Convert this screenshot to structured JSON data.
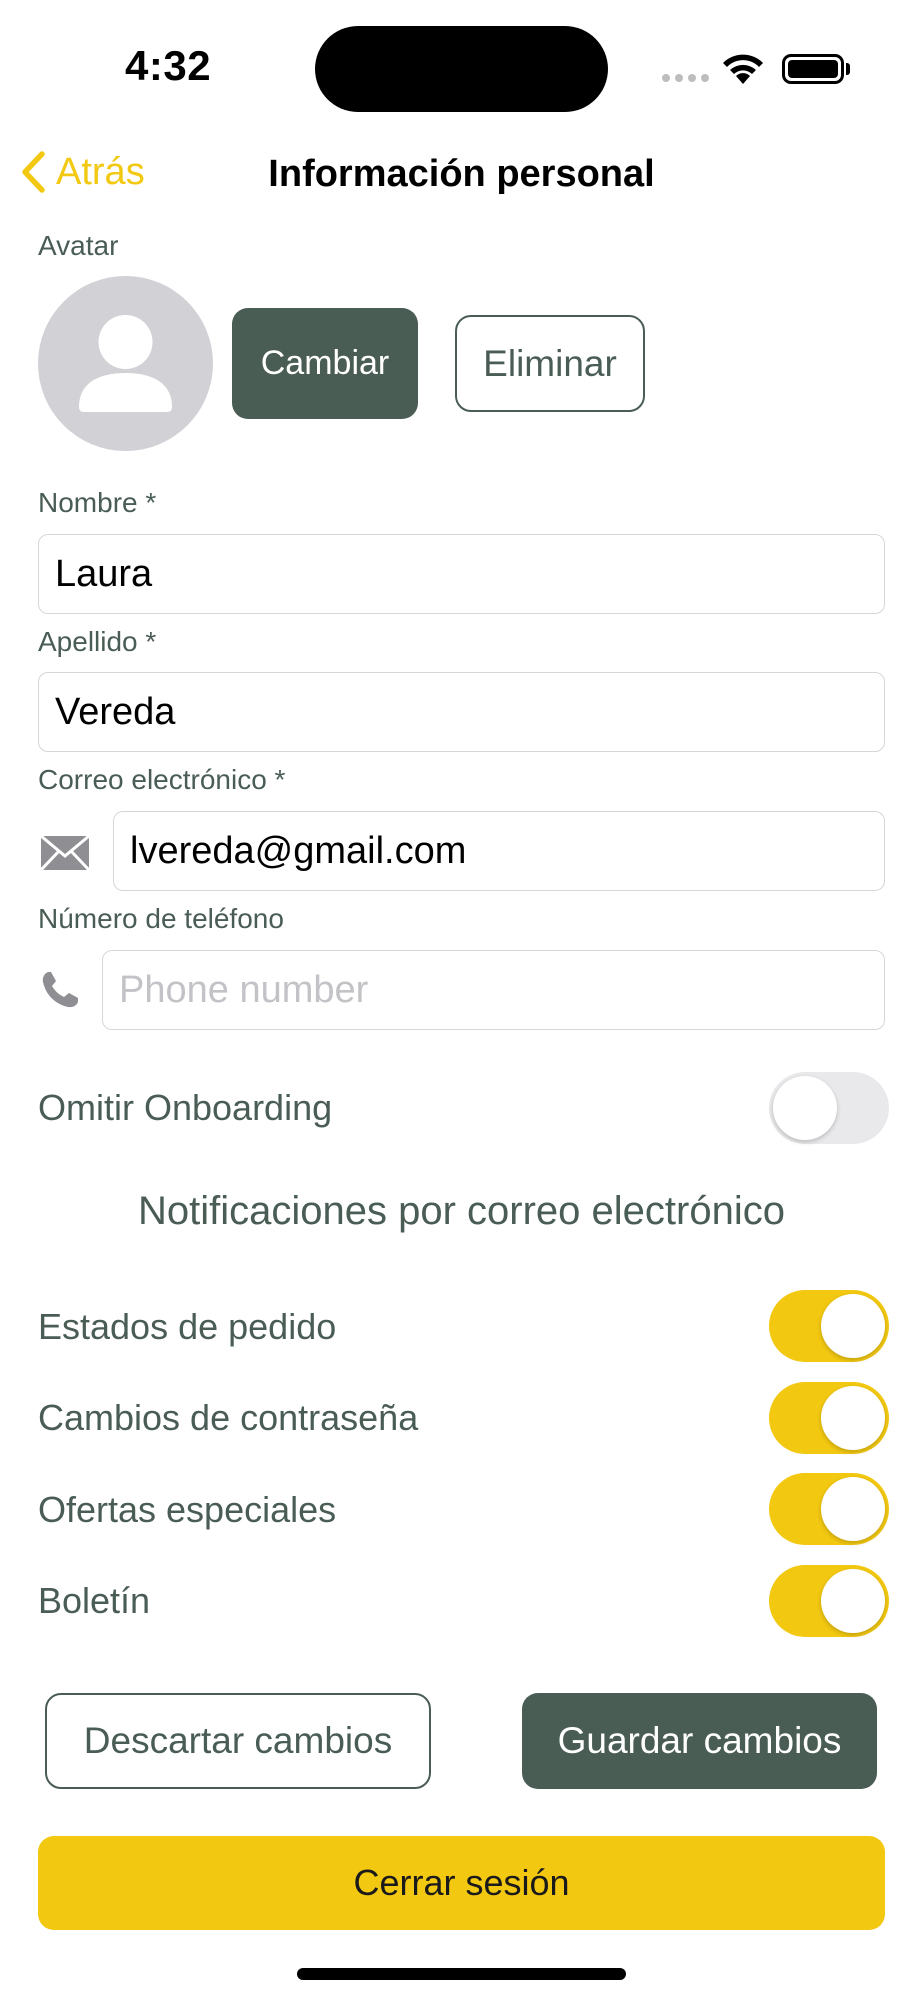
{
  "status_bar": {
    "time": "4:32"
  },
  "nav": {
    "back_label": "Atrás",
    "title": "Información personal"
  },
  "avatar": {
    "label": "Avatar",
    "change_label": "Cambiar",
    "remove_label": "Eliminar"
  },
  "form": {
    "first_name": {
      "label": "Nombre *",
      "value": "Laura"
    },
    "last_name": {
      "label": "Apellido *",
      "value": "Vereda"
    },
    "email": {
      "label": "Correo electrónico *",
      "value": "lvereda@gmail.com"
    },
    "phone": {
      "label": "Número de teléfono",
      "value": "",
      "placeholder": "Phone number"
    }
  },
  "skip_onboarding": {
    "label": "Omitir Onboarding",
    "on": false
  },
  "notifications": {
    "heading": "Notificaciones por correo electrónico",
    "items": [
      {
        "label": "Estados de pedido",
        "on": true
      },
      {
        "label": "Cambios de contraseña",
        "on": true
      },
      {
        "label": "Ofertas especiales",
        "on": true
      },
      {
        "label": "Boletín",
        "on": true
      }
    ]
  },
  "actions": {
    "discard_label": "Descartar cambios",
    "save_label": "Guardar cambios",
    "logout_label": "Cerrar sesión"
  },
  "colors": {
    "accent": "#f2c811",
    "primary": "#4a5d55",
    "avatar_bg": "#d1d1d6"
  }
}
